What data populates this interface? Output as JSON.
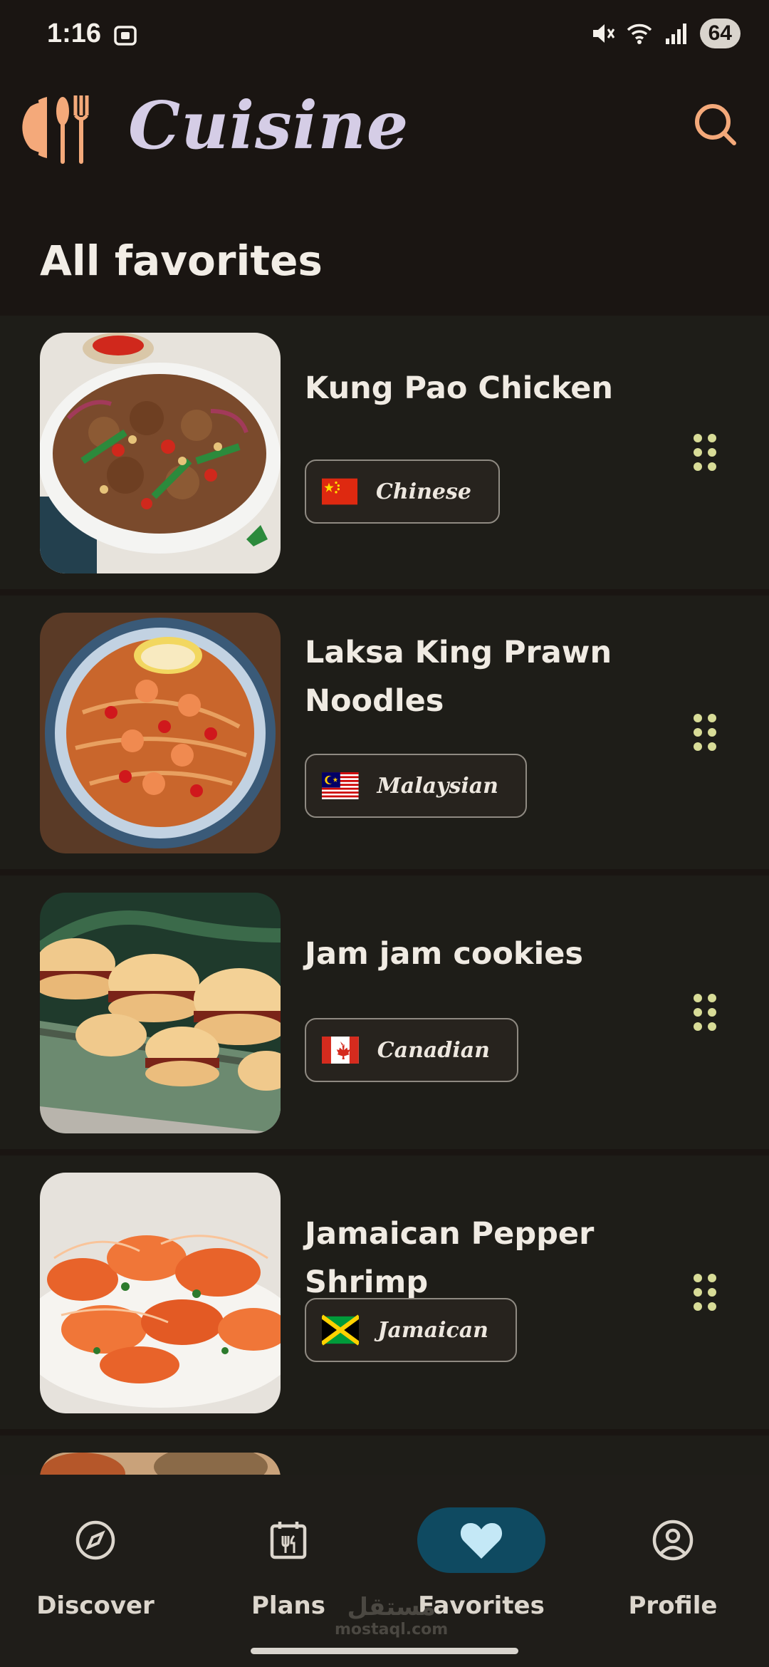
{
  "status_bar": {
    "time": "1:16",
    "battery": "64"
  },
  "header": {
    "app_title": "Cuisine",
    "page_title": "All favorites"
  },
  "favorites": [
    {
      "title": "Kung Pao Chicken",
      "cuisine": "Chinese",
      "flag": "china-flag-icon"
    },
    {
      "title": "Laksa King Prawn Noodles",
      "cuisine": "Malaysian",
      "flag": "malaysia-flag-icon"
    },
    {
      "title": "Jam jam cookies",
      "cuisine": "Canadian",
      "flag": "canada-flag-icon"
    },
    {
      "title": "Jamaican Pepper Shrimp",
      "cuisine": "Jamaican",
      "flag": "jamaica-flag-icon"
    }
  ],
  "bottom_nav": [
    {
      "label": "Discover",
      "icon": "compass-icon",
      "active": false
    },
    {
      "label": "Plans",
      "icon": "calendar-icon",
      "active": false
    },
    {
      "label": "Favorites",
      "icon": "heart-icon",
      "active": true
    },
    {
      "label": "Profile",
      "icon": "user-circle-icon",
      "active": false
    }
  ],
  "watermark": {
    "arabic": "مستقل",
    "latin": "mostaql.com"
  },
  "colors": {
    "background": "#1a1512",
    "card": "#1e1d18",
    "accent": "#f4a97a",
    "title": "#d5cde6",
    "nav_active": "#0f4a61",
    "handle": "#d8dc97"
  }
}
